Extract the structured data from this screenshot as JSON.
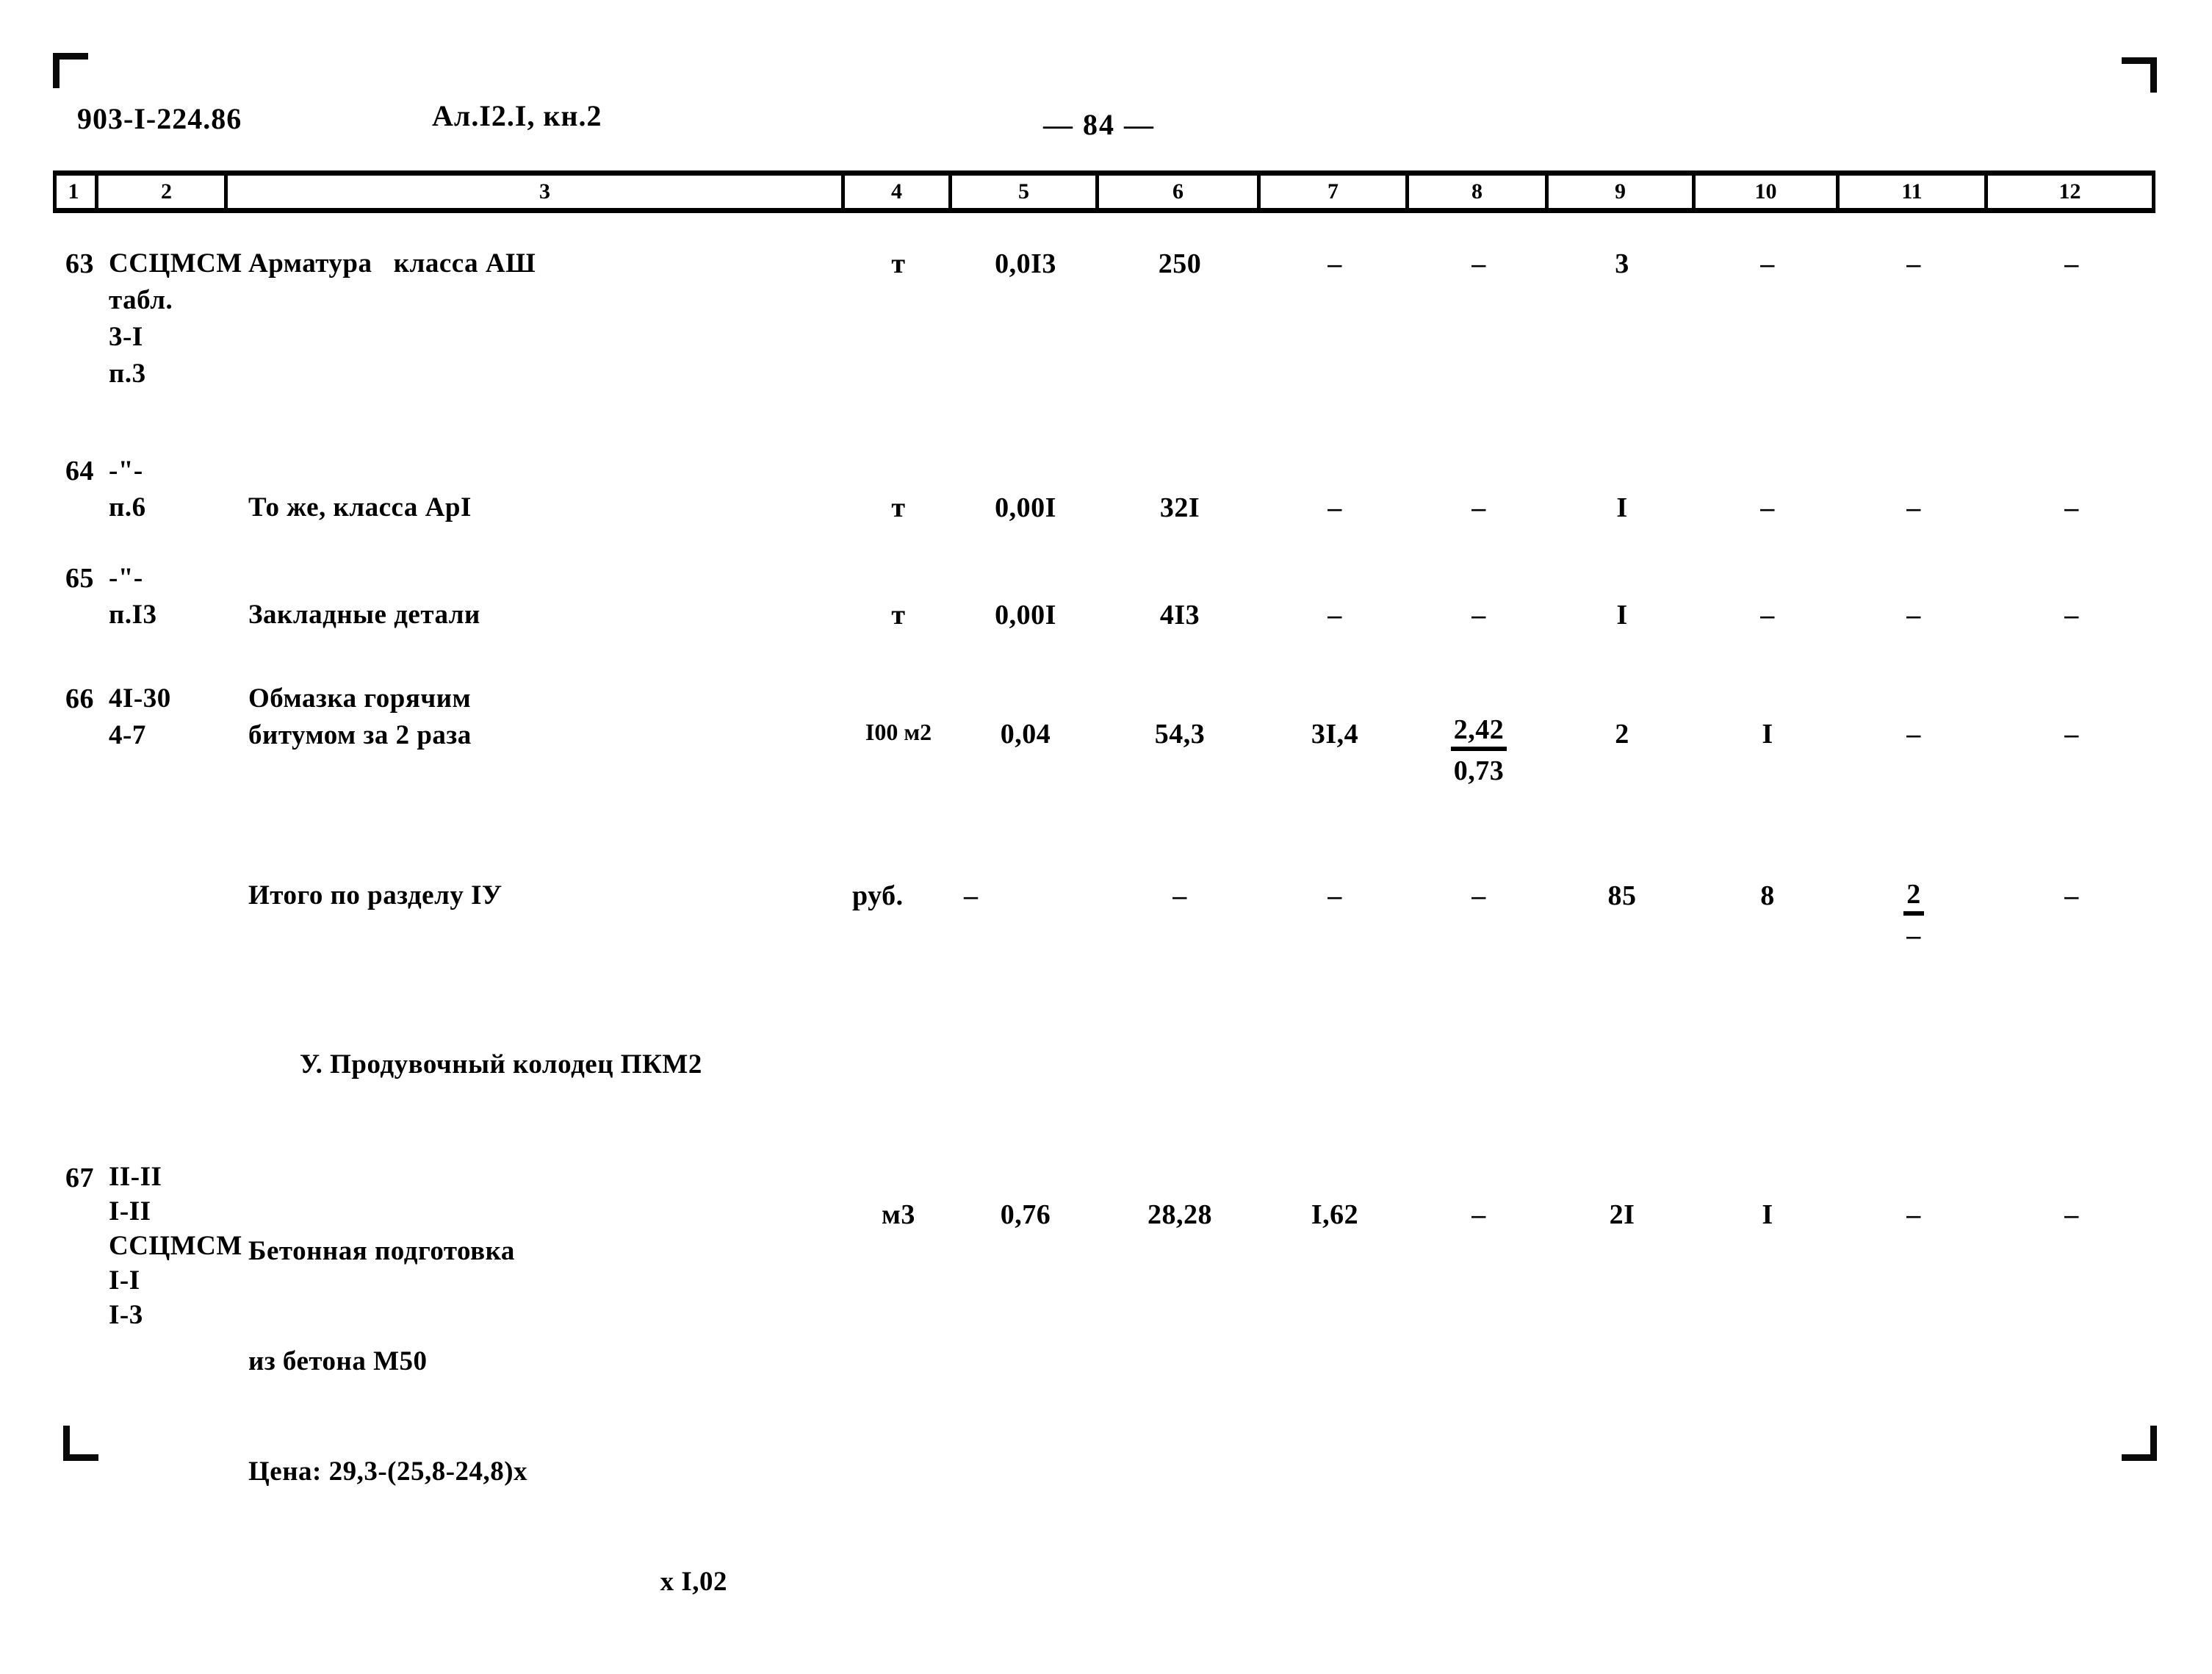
{
  "header": {
    "doc_code": "903-I-224.86",
    "album": "Ал.I2.I, кн.2",
    "page_number": "— 84 —"
  },
  "table": {
    "column_numbers": [
      "1",
      "2",
      "3",
      "4",
      "5",
      "6",
      "7",
      "8",
      "9",
      "10",
      "11",
      "12"
    ],
    "rows": [
      {
        "no": "63",
        "code": "ССЦМСМ\nтабл.\n3-I\nп.3",
        "name": "Арматура   класса АШ",
        "unit": "т",
        "c5": "0,0I3",
        "c6": "250",
        "c7": "–",
        "c8": "–",
        "c9": "3",
        "c10": "–",
        "c11": "–",
        "c12": "–"
      },
      {
        "no": "64",
        "code": "-\"-\nп.6",
        "name": "То же, класса АрI",
        "unit": "т",
        "c5": "0,00I",
        "c6": "32I",
        "c7": "–",
        "c8": "–",
        "c9": "I",
        "c10": "–",
        "c11": "–",
        "c12": "–"
      },
      {
        "no": "65",
        "code": "-\"-\nп.I3",
        "name": "Закладные детали",
        "unit": "т",
        "c5": "0,00I",
        "c6": "4I3",
        "c7": "–",
        "c8": "–",
        "c9": "I",
        "c10": "–",
        "c11": "–",
        "c12": "–"
      },
      {
        "no": "66",
        "code": "4I-30\n4-7",
        "name": "Обмазка горячим\nбитумом за 2 раза",
        "unit": "I00\nм2",
        "c5": "0,04",
        "c6": "54,3",
        "c7": "3I,4",
        "c8_top": "2,42",
        "c8_bottom": "0,73",
        "c9": "2",
        "c10": "I",
        "c11": "–",
        "c12": "–"
      }
    ],
    "total_row": {
      "no": "",
      "code": "",
      "name": "Итого по разделу IУ",
      "unit": "руб.",
      "c5_before_unit": "–",
      "c5": "–",
      "c6": "–",
      "c7": "–",
      "c8": "–",
      "c9": "85",
      "c10": "8",
      "c11_top": "2",
      "c11_bottom": "–",
      "c12": "–"
    },
    "section_title": "У. Продувочный колодец ПКМ2",
    "rows_after_section": [
      {
        "no": "67",
        "code": "II-II\nI-II\nССЦМСМ\nI-I\nI-3",
        "name_line1": "Бетонная подготовка",
        "name_line2": "из бетона М50",
        "name_line3": "Цена: 29,3-(25,8-24,8)х",
        "name_line4": "х I,02",
        "unit": "м3",
        "c5": "0,76",
        "c6": "28,28",
        "c7": "I,62",
        "c8": "–",
        "c9": "2I",
        "c10": "I",
        "c11": "–",
        "c12": "–"
      }
    ]
  }
}
